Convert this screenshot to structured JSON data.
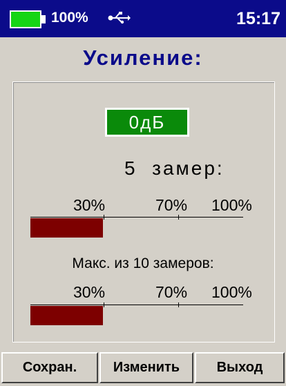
{
  "status": {
    "battery_percent": "100%",
    "battery_level": 1.0,
    "clock": "15:17",
    "battery_color": "#15d515",
    "usb_icon": "usb-icon"
  },
  "title": "Усиление:",
  "gain": {
    "value": "0дБ",
    "color": "#0a8a0a"
  },
  "current": {
    "label": "5  замер:",
    "scale_labels": [
      "30%",
      "70%",
      "100%"
    ],
    "level_percent": 34
  },
  "max": {
    "label": "Макс. из 10 замеров:",
    "scale_labels": [
      "30%",
      "70%",
      "100%"
    ],
    "level_percent": 34
  },
  "bar_color": "#7d0000",
  "accent_color": "#0b0b8a",
  "buttons": {
    "save": "Сохран.",
    "change": "Изменить",
    "exit": "Выход"
  }
}
